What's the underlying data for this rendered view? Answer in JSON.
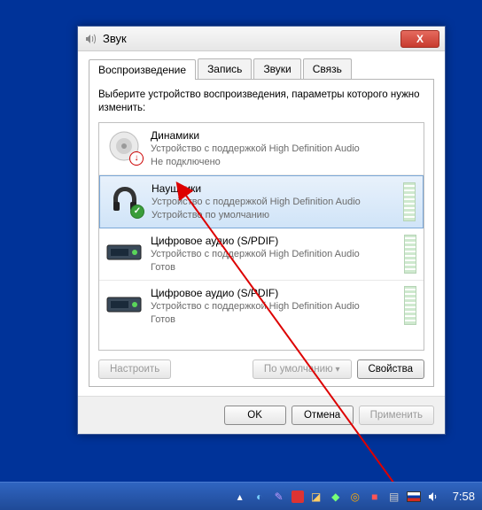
{
  "window": {
    "title": "Звук"
  },
  "tabs": [
    "Воспроизведение",
    "Запись",
    "Звуки",
    "Связь"
  ],
  "instruction": "Выберите устройство воспроизведения, параметры которого нужно изменить:",
  "devices": [
    {
      "name": "Динамики",
      "desc": "Устройство с поддержкой High Definition Audio",
      "status": "Не подключено",
      "icon": "speaker",
      "badge": "down",
      "selected": false
    },
    {
      "name": "Наушники",
      "desc": "Устройство с поддержкой High Definition Audio",
      "status": "Устройство по умолчанию",
      "icon": "headphones",
      "badge": "check",
      "selected": true
    },
    {
      "name": "Цифровое аудио (S/PDIF)",
      "desc": "Устройство с поддержкой High Definition Audio",
      "status": "Готов",
      "icon": "spdif",
      "badge": "",
      "selected": false
    },
    {
      "name": "Цифровое аудио (S/PDIF)",
      "desc": "Устройство с поддержкой High Definition Audio",
      "status": "Готов",
      "icon": "spdif",
      "badge": "",
      "selected": false
    }
  ],
  "buttons": {
    "configure": "Настроить",
    "default": "По умолчанию",
    "props": "Свойства",
    "ok": "OK",
    "cancel": "Отмена",
    "apply": "Применить"
  },
  "clock": "7:58"
}
